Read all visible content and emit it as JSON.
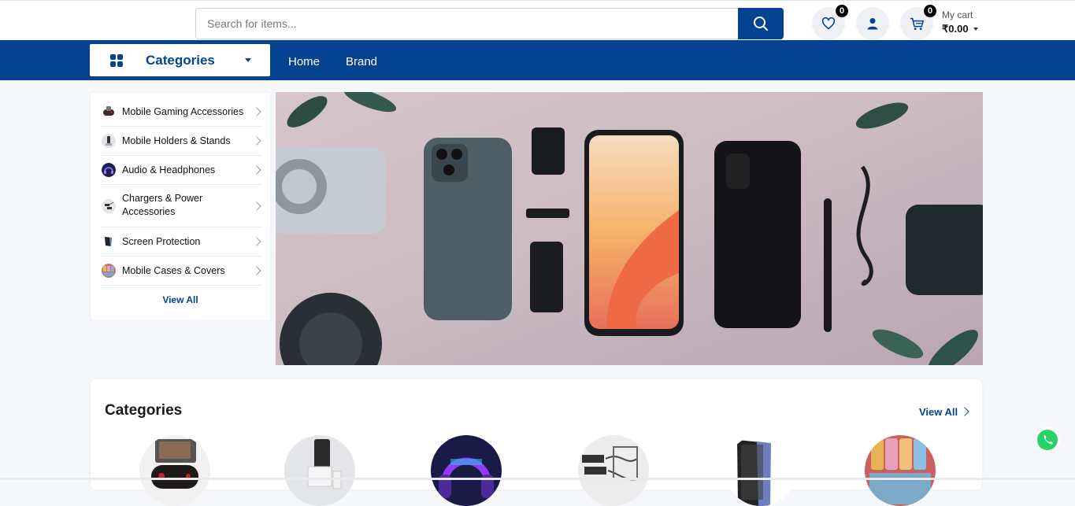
{
  "header": {
    "search": {
      "placeholder": "Search for items..."
    },
    "wishlist": {
      "count": "0"
    },
    "cart": {
      "count": "0",
      "label": "My cart",
      "value": "₹0.00"
    }
  },
  "nav": {
    "categories_label": "Categories",
    "links": [
      "Home",
      "Brand"
    ]
  },
  "sidebar": {
    "items": [
      {
        "label": "Mobile Gaming Accessories",
        "icon": "gamepad-icon"
      },
      {
        "label": "Mobile Holders & Stands",
        "icon": "holder-icon"
      },
      {
        "label": "Audio & Headphones",
        "icon": "headphones-icon"
      },
      {
        "label": "Chargers & Power Accessories",
        "icon": "charger-icon"
      },
      {
        "label": "Screen Protection",
        "icon": "screen-icon"
      },
      {
        "label": "Mobile Cases & Covers",
        "icon": "case-icon"
      }
    ],
    "view_all": "View All"
  },
  "banner": {
    "slide_count": 3,
    "active_slide": 2
  },
  "categories_section": {
    "title": "Categories",
    "view_all": "View All",
    "items": [
      {
        "icon": "gamepad-icon"
      },
      {
        "icon": "holder-icon"
      },
      {
        "icon": "headphones-icon"
      },
      {
        "icon": "charger-icon"
      },
      {
        "icon": "screen-icon"
      },
      {
        "icon": "case-icon"
      }
    ]
  },
  "colors": {
    "brand": "#054292",
    "accent_whatsapp": "#25d366"
  }
}
